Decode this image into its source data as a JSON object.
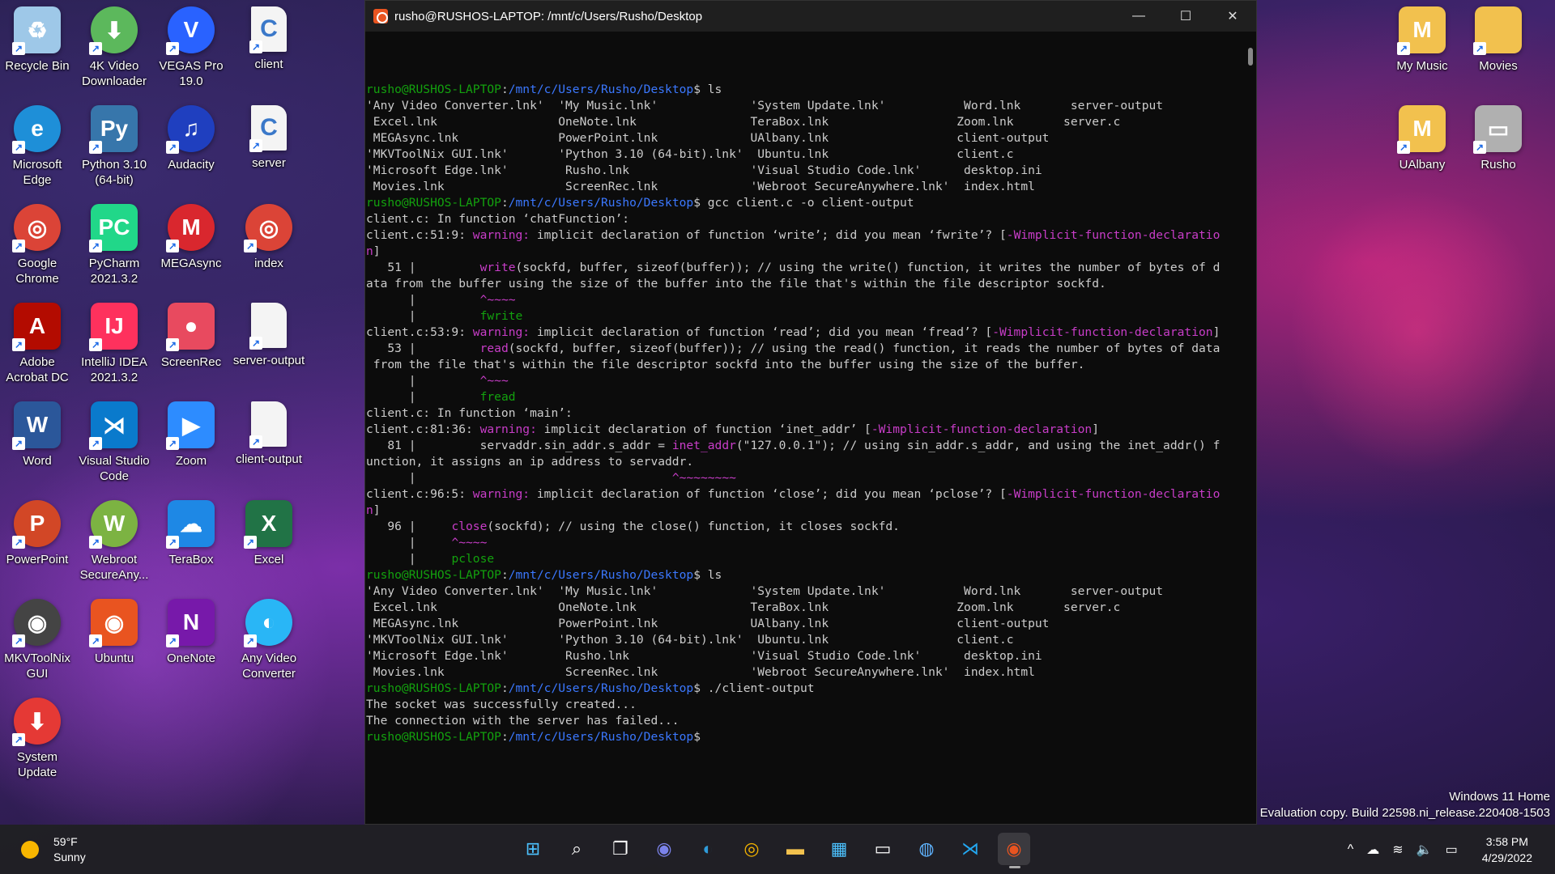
{
  "desktop": {
    "left_icons": [
      {
        "label": "Recycle Bin",
        "icon": "recycle-bin-icon"
      },
      {
        "label": "4K Video Downloader",
        "icon": "4k-video-downloader-icon"
      },
      {
        "label": "VEGAS Pro 19.0",
        "icon": "vegas-pro-icon"
      },
      {
        "label": "client",
        "icon": "c-file-icon"
      },
      {
        "label": "Microsoft Edge",
        "icon": "edge-icon"
      },
      {
        "label": "Python 3.10 (64-bit)",
        "icon": "python-icon"
      },
      {
        "label": "Audacity",
        "icon": "audacity-icon"
      },
      {
        "label": "server",
        "icon": "c-file-icon"
      },
      {
        "label": "Google Chrome",
        "icon": "chrome-icon"
      },
      {
        "label": "PyCharm 2021.3.2",
        "icon": "pycharm-icon"
      },
      {
        "label": "MEGAsync",
        "icon": "megasync-icon"
      },
      {
        "label": "index",
        "icon": "chrome-icon"
      },
      {
        "label": "Adobe Acrobat DC",
        "icon": "acrobat-icon"
      },
      {
        "label": "IntelliJ IDEA 2021.3.2",
        "icon": "intellij-icon"
      },
      {
        "label": "ScreenRec",
        "icon": "screenrec-icon"
      },
      {
        "label": "server-output",
        "icon": "blank-file-icon"
      },
      {
        "label": "Word",
        "icon": "word-icon"
      },
      {
        "label": "Visual Studio Code",
        "icon": "vscode-icon"
      },
      {
        "label": "Zoom",
        "icon": "zoom-icon"
      },
      {
        "label": "client-output",
        "icon": "blank-file-icon"
      },
      {
        "label": "PowerPoint",
        "icon": "powerpoint-icon"
      },
      {
        "label": "Webroot SecureAny...",
        "icon": "webroot-icon"
      },
      {
        "label": "TeraBox",
        "icon": "terabox-icon"
      },
      {
        "label": "Excel",
        "icon": "excel-icon"
      },
      {
        "label": "MKVToolNix GUI",
        "icon": "mkvtoolnix-icon"
      },
      {
        "label": "Ubuntu",
        "icon": "ubuntu-icon"
      },
      {
        "label": "OneNote",
        "icon": "onenote-icon"
      },
      {
        "label": "Any Video Converter",
        "icon": "any-video-converter-icon"
      },
      {
        "label": "System Update",
        "icon": "system-update-icon"
      }
    ],
    "right_icons": [
      {
        "label": "My Music",
        "icon": "folder-mega-icon"
      },
      {
        "label": "Movies",
        "icon": "folder-icon"
      },
      {
        "label": "UAlbany",
        "icon": "folder-mega-icon"
      },
      {
        "label": "Rusho",
        "icon": "drive-icon"
      }
    ],
    "watermark": {
      "line1": "Windows 11 Home",
      "line2": "Evaluation copy. Build 22598.ni_release.220408-1503"
    }
  },
  "terminal": {
    "title": "rusho@RUSHOS-LAPTOP: /mnt/c/Users/Rusho/Desktop",
    "controls": {
      "minimize": "—",
      "maximize": "☐",
      "close": "✕"
    },
    "lines": [
      [
        {
          "t": "rusho@RUSHOS-LAPTOP",
          "c": "user"
        },
        {
          "t": ":",
          "c": ""
        },
        {
          "t": "/mnt/c/Users/Rusho/Desktop",
          "c": "path"
        },
        {
          "t": "$ ls",
          "c": ""
        }
      ],
      [
        {
          "t": "'Any Video Converter.lnk'  'My Music.lnk'             'System Update.lnk'           Word.lnk       server-output",
          "c": ""
        }
      ],
      [
        {
          "t": " Excel.lnk                 OneNote.lnk                TeraBox.lnk                  Zoom.lnk       server.c",
          "c": ""
        }
      ],
      [
        {
          "t": " MEGAsync.lnk              PowerPoint.lnk             UAlbany.lnk                  client-output",
          "c": ""
        }
      ],
      [
        {
          "t": "'MKVToolNix GUI.lnk'       'Python 3.10 (64-bit).lnk'  Ubuntu.lnk                  client.c",
          "c": ""
        }
      ],
      [
        {
          "t": "'Microsoft Edge.lnk'        Rusho.lnk                 'Visual Studio Code.lnk'      desktop.ini",
          "c": ""
        }
      ],
      [
        {
          "t": " Movies.lnk                 ScreenRec.lnk             'Webroot SecureAnywhere.lnk'  index.html",
          "c": ""
        }
      ],
      [
        {
          "t": "rusho@RUSHOS-LAPTOP",
          "c": "user"
        },
        {
          "t": ":",
          "c": ""
        },
        {
          "t": "/mnt/c/Users/Rusho/Desktop",
          "c": "path"
        },
        {
          "t": "$ gcc client.c -o client-output",
          "c": ""
        }
      ],
      [
        {
          "t": "client.c: In function ‘chatFunction’:",
          "c": ""
        }
      ],
      [
        {
          "t": "client.c:51:9: ",
          "c": ""
        },
        {
          "t": "warning:",
          "c": "warn"
        },
        {
          "t": " implicit declaration of function ‘write’; did you mean ‘fwrite’? [",
          "c": ""
        },
        {
          "t": "-Wimplicit-function-declaratio",
          "c": "warn"
        }
      ],
      [
        {
          "t": "n",
          "c": "warn"
        },
        {
          "t": "]",
          "c": ""
        }
      ],
      [
        {
          "t": "   51 |         ",
          "c": ""
        },
        {
          "t": "write",
          "c": "warn"
        },
        {
          "t": "(sockfd, buffer, sizeof(buffer)); // using the write() function, it writes the number of bytes of d",
          "c": ""
        }
      ],
      [
        {
          "t": "ata from the buffer using the size of the buffer into the file that's within the file descriptor sockfd.",
          "c": ""
        }
      ],
      [
        {
          "t": "      |         ",
          "c": ""
        },
        {
          "t": "^~~~~",
          "c": "warn"
        }
      ],
      [
        {
          "t": "      |         ",
          "c": ""
        },
        {
          "t": "fwrite",
          "c": "green"
        }
      ],
      [
        {
          "t": "client.c:53:9: ",
          "c": ""
        },
        {
          "t": "warning:",
          "c": "warn"
        },
        {
          "t": " implicit declaration of function ‘read’; did you mean ‘fread’? [",
          "c": ""
        },
        {
          "t": "-Wimplicit-function-declaration",
          "c": "warn"
        },
        {
          "t": "]",
          "c": ""
        }
      ],
      [
        {
          "t": "   53 |         ",
          "c": ""
        },
        {
          "t": "read",
          "c": "warn"
        },
        {
          "t": "(sockfd, buffer, sizeof(buffer)); // using the read() function, it reads the number of bytes of data",
          "c": ""
        }
      ],
      [
        {
          "t": " from the file that's within the file descriptor sockfd into the buffer using the size of the buffer.",
          "c": ""
        }
      ],
      [
        {
          "t": "      |         ",
          "c": ""
        },
        {
          "t": "^~~~",
          "c": "warn"
        }
      ],
      [
        {
          "t": "      |         ",
          "c": ""
        },
        {
          "t": "fread",
          "c": "green"
        }
      ],
      [
        {
          "t": "client.c: In function ‘main’:",
          "c": ""
        }
      ],
      [
        {
          "t": "client.c:81:36: ",
          "c": ""
        },
        {
          "t": "warning:",
          "c": "warn"
        },
        {
          "t": " implicit declaration of function ‘inet_addr’ [",
          "c": ""
        },
        {
          "t": "-Wimplicit-function-declaration",
          "c": "warn"
        },
        {
          "t": "]",
          "c": ""
        }
      ],
      [
        {
          "t": "   81 |         servaddr.sin_addr.s_addr = ",
          "c": ""
        },
        {
          "t": "inet_addr",
          "c": "warn"
        },
        {
          "t": "(\"127.0.0.1\"); // using sin_addr.s_addr, and using the inet_addr() f",
          "c": ""
        }
      ],
      [
        {
          "t": "unction, it assigns an ip address to servaddr.",
          "c": ""
        }
      ],
      [
        {
          "t": "      |                                    ",
          "c": ""
        },
        {
          "t": "^~~~~~~~~",
          "c": "warn"
        }
      ],
      [
        {
          "t": "client.c:96:5: ",
          "c": ""
        },
        {
          "t": "warning:",
          "c": "warn"
        },
        {
          "t": " implicit declaration of function ‘close’; did you mean ‘pclose’? [",
          "c": ""
        },
        {
          "t": "-Wimplicit-function-declaratio",
          "c": "warn"
        }
      ],
      [
        {
          "t": "n",
          "c": "warn"
        },
        {
          "t": "]",
          "c": ""
        }
      ],
      [
        {
          "t": "   96 |     ",
          "c": ""
        },
        {
          "t": "close",
          "c": "warn"
        },
        {
          "t": "(sockfd); // using the close() function, it closes sockfd.",
          "c": ""
        }
      ],
      [
        {
          "t": "      |     ",
          "c": ""
        },
        {
          "t": "^~~~~",
          "c": "warn"
        }
      ],
      [
        {
          "t": "      |     ",
          "c": ""
        },
        {
          "t": "pclose",
          "c": "green"
        }
      ],
      [
        {
          "t": "rusho@RUSHOS-LAPTOP",
          "c": "user"
        },
        {
          "t": ":",
          "c": ""
        },
        {
          "t": "/mnt/c/Users/Rusho/Desktop",
          "c": "path"
        },
        {
          "t": "$ ls",
          "c": ""
        }
      ],
      [
        {
          "t": "'Any Video Converter.lnk'  'My Music.lnk'             'System Update.lnk'           Word.lnk       server-output",
          "c": ""
        }
      ],
      [
        {
          "t": " Excel.lnk                 OneNote.lnk                TeraBox.lnk                  Zoom.lnk       server.c",
          "c": ""
        }
      ],
      [
        {
          "t": " MEGAsync.lnk              PowerPoint.lnk             UAlbany.lnk                  client-output",
          "c": ""
        }
      ],
      [
        {
          "t": "'MKVToolNix GUI.lnk'       'Python 3.10 (64-bit).lnk'  Ubuntu.lnk                  client.c",
          "c": ""
        }
      ],
      [
        {
          "t": "'Microsoft Edge.lnk'        Rusho.lnk                 'Visual Studio Code.lnk'      desktop.ini",
          "c": ""
        }
      ],
      [
        {
          "t": " Movies.lnk                 ScreenRec.lnk             'Webroot SecureAnywhere.lnk'  index.html",
          "c": ""
        }
      ],
      [
        {
          "t": "rusho@RUSHOS-LAPTOP",
          "c": "user"
        },
        {
          "t": ":",
          "c": ""
        },
        {
          "t": "/mnt/c/Users/Rusho/Desktop",
          "c": "path"
        },
        {
          "t": "$ ./client-output",
          "c": ""
        }
      ],
      [
        {
          "t": "The socket was successfully created...",
          "c": ""
        }
      ],
      [
        {
          "t": "The connection with the server has failed...",
          "c": ""
        }
      ],
      [
        {
          "t": "rusho@RUSHOS-LAPTOP",
          "c": "user"
        },
        {
          "t": ":",
          "c": ""
        },
        {
          "t": "/mnt/c/Users/Rusho/Desktop",
          "c": "path"
        },
        {
          "t": "$",
          "c": ""
        }
      ]
    ]
  },
  "taskbar": {
    "weather": {
      "temp": "59°F",
      "condition": "Sunny"
    },
    "apps": [
      {
        "name": "start",
        "glyph": "⊞"
      },
      {
        "name": "search",
        "glyph": "⌕"
      },
      {
        "name": "task-view",
        "glyph": "❐"
      },
      {
        "name": "teams-chat",
        "glyph": "◉"
      },
      {
        "name": "edge",
        "glyph": "◐"
      },
      {
        "name": "chrome",
        "glyph": "◎"
      },
      {
        "name": "file-explorer",
        "glyph": "▬"
      },
      {
        "name": "store",
        "glyph": "▦"
      },
      {
        "name": "terminal",
        "glyph": "▭"
      },
      {
        "name": "browser",
        "glyph": "◍"
      },
      {
        "name": "vscode",
        "glyph": "⋊"
      },
      {
        "name": "ubuntu",
        "glyph": "◉"
      }
    ],
    "tray": {
      "chevron": "^",
      "cloud": "☁",
      "wifi": "≋",
      "volume": "🔈",
      "battery": "▭"
    },
    "clock": {
      "time": "3:58 PM",
      "date": "4/29/2022"
    }
  }
}
